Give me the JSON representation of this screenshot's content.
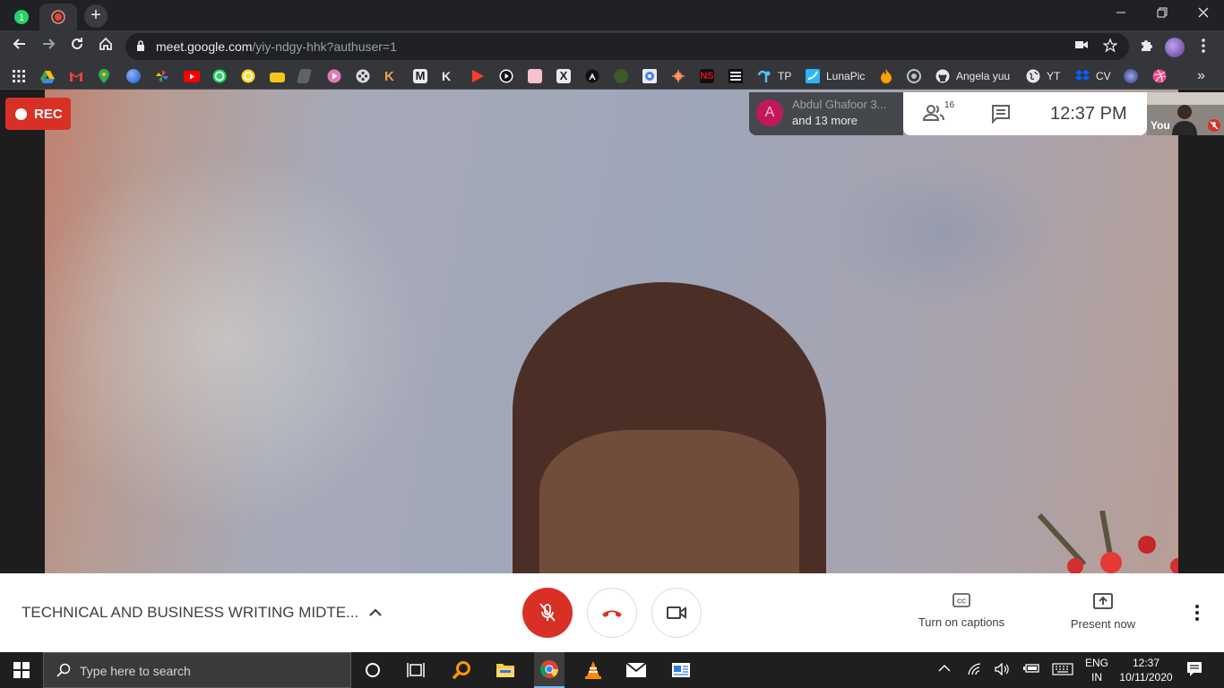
{
  "browser": {
    "tabs": [
      {
        "badge": "1"
      },
      {
        "recording": true
      }
    ],
    "url_host": "meet.google.com",
    "url_path": "/yiy-ndgy-hhk?authuser=1",
    "bookmarks": [
      {
        "label": "TP",
        "icon": "tp-icon"
      },
      {
        "label": "LunaPic",
        "icon": "lunapic-icon"
      },
      {
        "label": "Angela yuu",
        "icon": "github-icon"
      },
      {
        "label": "YT",
        "icon": "globe-icon"
      },
      {
        "label": "CV",
        "icon": "dropbox-icon"
      }
    ],
    "more_bookmarks": "»"
  },
  "meeting": {
    "rec_label": "REC",
    "participant_avatar": "A",
    "participant_name": "Abdul Ghafoor 3...",
    "participant_more": "and 13 more",
    "participant_count": "16",
    "time": "12:37  PM",
    "self_label": "You",
    "title": "TECHNICAL AND BUSINESS WRITING MIDTE...",
    "captions_label": "Turn on captions",
    "present_label": "Present now"
  },
  "taskbar": {
    "search_placeholder": "Type here to search",
    "lang_line1": "ENG",
    "lang_line2": "IN",
    "time": "12:37",
    "date": "10/11/2020"
  }
}
